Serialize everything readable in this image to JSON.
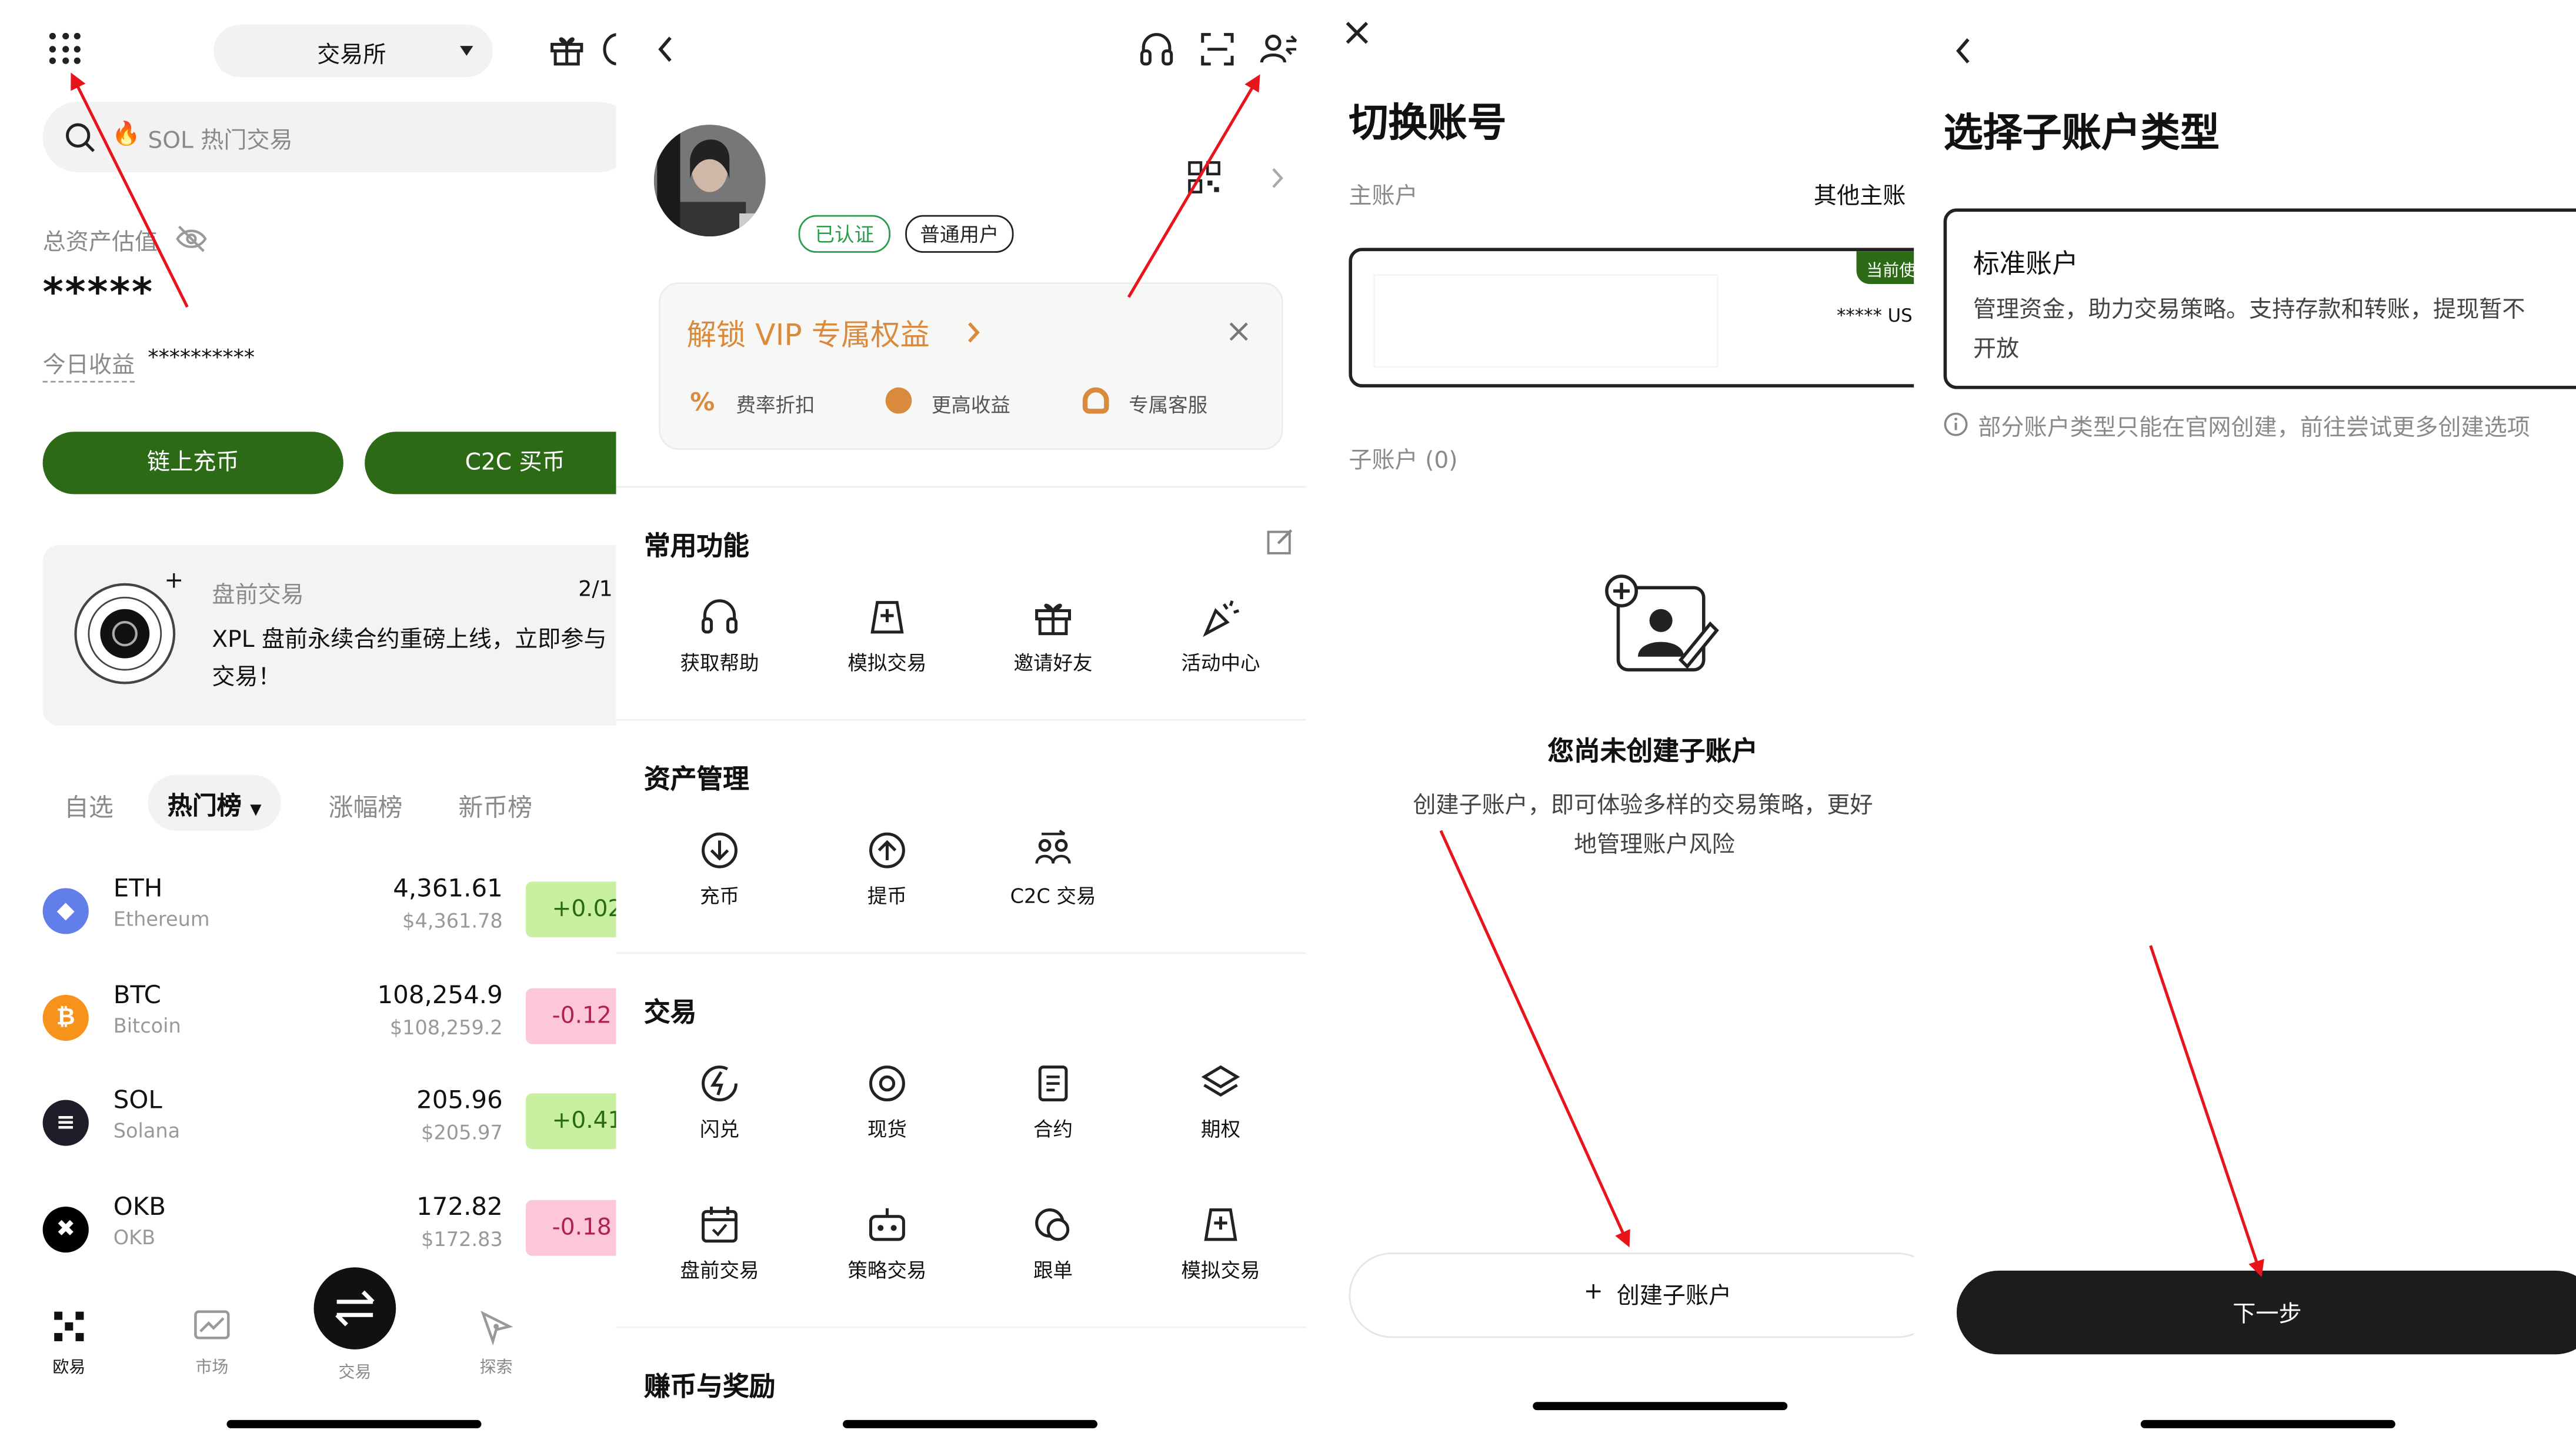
{
  "panel1": {
    "exchange_selector": "交易所",
    "search_placeholder": "SOL 热门交易",
    "search_emoji": "🔥",
    "asset_label": "总资产估值",
    "asset_value": "*****",
    "today_label": "今日收益",
    "today_value": "**********",
    "deposit_button": "链上充币",
    "c2c_button": "C2C 买币",
    "card_title": "盘前交易",
    "card_page": "2/1",
    "card_text_1": "XPL 盘前永续合约重磅上线，立即参与",
    "card_text_2": "交易！",
    "tabs": [
      "自选",
      "热门榜",
      "涨幅榜",
      "新币榜"
    ],
    "coins": [
      {
        "symbol": "ETH",
        "name": "Ethereum",
        "price": "4,361.61",
        "usd": "$4,361.78",
        "change": "+0.02",
        "dir": "up",
        "color": "#627eea",
        "glyph": "◆"
      },
      {
        "symbol": "BTC",
        "name": "Bitcoin",
        "price": "108,254.9",
        "usd": "$108,259.2",
        "change": "-0.12",
        "dir": "down",
        "color": "#f7931a",
        "glyph": "₿"
      },
      {
        "symbol": "SOL",
        "name": "Solana",
        "price": "205.96",
        "usd": "$205.97",
        "change": "+0.41",
        "dir": "up",
        "color": "#1e1e2a",
        "glyph": "≡"
      },
      {
        "symbol": "OKB",
        "name": "OKB",
        "price": "172.82",
        "usd": "$172.83",
        "change": "-0.18",
        "dir": "down",
        "color": "#000000",
        "glyph": "✖"
      }
    ],
    "nav": [
      "欧易",
      "市场",
      "交易",
      "探索"
    ]
  },
  "panel2": {
    "badge_verified": "已认证",
    "badge_user": "普通用户",
    "vip_title": "解锁 VIP 专属权益",
    "vip_items": [
      "费率折扣",
      "更高收益",
      "专属客服"
    ],
    "section_common": "常用功能",
    "common_items": [
      "获取帮助",
      "模拟交易",
      "邀请好友",
      "活动中心"
    ],
    "section_assets": "资产管理",
    "asset_items": [
      "充币",
      "提币",
      "C2C 交易"
    ],
    "section_trade": "交易",
    "trade_items": [
      "闪兑",
      "现货",
      "合约",
      "期权",
      "盘前交易",
      "策略交易",
      "跟单",
      "模拟交易"
    ],
    "section_earn": "赚币与奖励"
  },
  "panel3": {
    "title": "切换账号",
    "main_account": "主账户",
    "other_main": "其他主账",
    "current_badge": "当前使",
    "masked_balance": "***** US",
    "sub_account_label": "子账户 (0)",
    "empty_title": "您尚未创建子账户",
    "empty_desc_1": "创建子账户，即可体验多样的交易策略，更好",
    "empty_desc_2": "地管理账户风险",
    "create_button": "创建子账户",
    "create_plus": "+"
  },
  "panel4": {
    "title": "选择子账户类型",
    "option_title": "标准账户",
    "option_desc_1": "管理资金，助力交易策略。支持存款和转账，提现暂不",
    "option_desc_2": "开放",
    "notice": "部分账户类型只能在官网创建，前往尝试更多创建选项",
    "next_button": "下一步"
  },
  "colors": {
    "brand_green": "#2d6a16",
    "vip_orange": "#d98a3d",
    "arrow_red": "#e8141c",
    "dark_button": "#1c1c1c"
  }
}
